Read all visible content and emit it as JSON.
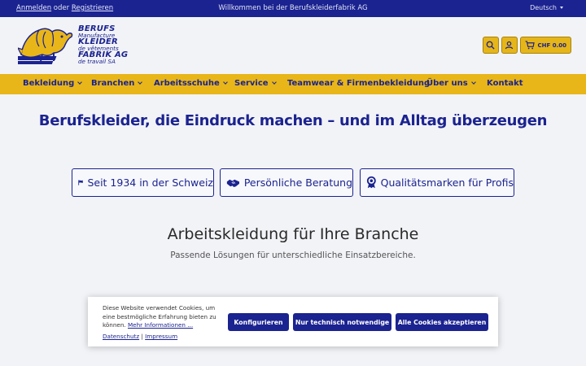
{
  "topbar": {
    "login": "Anmelden",
    "or": "oder",
    "register": "Registrieren",
    "welcome": "Willkommen bei der Berufskleiderfabrik AG",
    "language": "Deutsch"
  },
  "logo": {
    "lines": [
      "BERUFS",
      "Manufacture",
      "KLEIDER",
      "de vêtements",
      "FABRIK AG",
      "de travail SA"
    ]
  },
  "header": {
    "icons": [
      "search-icon",
      "user-icon",
      "cart-icon"
    ],
    "cart_amount": "CHF 0.00"
  },
  "nav": {
    "items": [
      {
        "label": "Bekleidung",
        "dropdown": true
      },
      {
        "label": "Branchen",
        "dropdown": true
      },
      {
        "label": "Arbeitsschuhe",
        "dropdown": true
      },
      {
        "label": "Service",
        "dropdown": true
      },
      {
        "label": "Teamwear & Firmenbekleidung",
        "dropdown": false
      },
      {
        "label": "Über uns",
        "dropdown": true
      },
      {
        "label": "Kontakt",
        "dropdown": false
      }
    ]
  },
  "hero": {
    "title": "Berufskleider, die Eindruck machen – und im Alltag überzeugen"
  },
  "features": [
    {
      "icon": "flag-icon",
      "label": "Seit 1934 in der Schweiz"
    },
    {
      "icon": "handshake-icon",
      "label": "Persönliche Beratung"
    },
    {
      "icon": "award-icon",
      "label": "Qualitätsmarken für Profis"
    }
  ],
  "section": {
    "title": "Arbeitskleidung für Ihre Branche",
    "subtitle": "Passende Lösungen für unterschiedliche Einsatzbereiche."
  },
  "cookie": {
    "message": "Diese Website verwendet Cookies, um eine bestmögliche Erfahrung bieten zu können.",
    "more_info": "Mehr Informationen ...",
    "privacy": "Datenschutz",
    "separator": "|",
    "imprint": "Impressum",
    "configure": "Konfigurieren",
    "necessary": "Nur technisch notwendige",
    "accept_all": "Alle Cookies akzeptieren"
  },
  "colors": {
    "brand_blue": "#1b2390",
    "brand_yellow": "#e8b618",
    "background": "#f2f3f7"
  }
}
